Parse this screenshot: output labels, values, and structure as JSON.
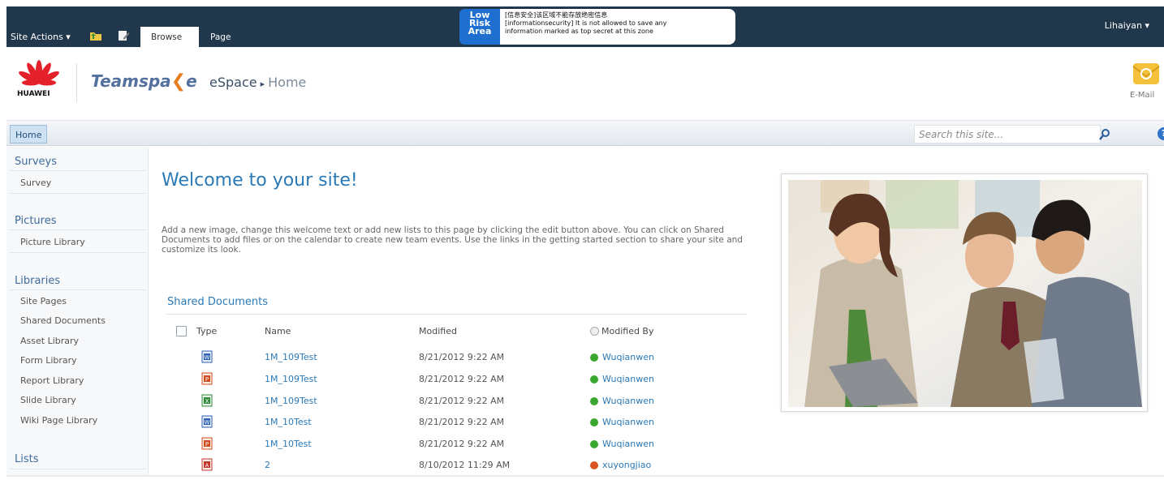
{
  "ribbon": {
    "site_actions": "Site Actions ▾",
    "tabs": [
      {
        "label": "Browse",
        "active": true
      },
      {
        "label": "Page",
        "active": false
      }
    ],
    "risk_badge": "Low Risk Area",
    "risk_badge_lines": [
      "Low",
      "Risk",
      "Area"
    ],
    "risk_message_cn": "[信息安全]该区域不能存放绝密信息",
    "risk_message_lines": [
      "[informationsecurity] It is not allowed to save any",
      "information marked as top secret at this zone"
    ],
    "user": "Lihaiyan ▾",
    "icons": [
      "folder-up-icon",
      "edit-page-icon"
    ]
  },
  "header": {
    "logo_text": "HUAWEI",
    "product_prefix": "Teamspa",
    "product_suffix": "e",
    "site_title": "eSpace",
    "current_page": "Home",
    "email_label": "E-Mail"
  },
  "topnav": {
    "home": "Home",
    "search_placeholder": "Search this site..."
  },
  "sidebar": {
    "sections": [
      {
        "heading": "Surveys",
        "items": [
          "Survey"
        ]
      },
      {
        "heading": "Pictures",
        "items": [
          "Picture Library"
        ]
      },
      {
        "heading": "Libraries",
        "items": [
          "Site Pages",
          "Shared Documents",
          "Asset Library",
          "Form Library",
          "Report Library",
          "Slide Library",
          "Wiki Page Library"
        ]
      },
      {
        "heading": "Lists",
        "items": []
      }
    ]
  },
  "main": {
    "welcome": "Welcome to your site!",
    "intro": "Add a new image, change this welcome text or add new lists to this page by clicking the edit button above. You can click on Shared Documents to add files or on the calendar to create new team events. Use the links in the getting started section to share your site and customize its look.",
    "shared_documents": {
      "title": "Shared Documents",
      "columns": [
        "Type",
        "Name",
        "Modified",
        "Modified By"
      ],
      "rows": [
        {
          "type": "word",
          "name": "1M_109Test",
          "modified": "8/21/2012 9:22 AM",
          "modified_by": "Wuqianwen",
          "presence": "online"
        },
        {
          "type": "powerpoint",
          "name": "1M_109Test",
          "modified": "8/21/2012 9:22 AM",
          "modified_by": "Wuqianwen",
          "presence": "online"
        },
        {
          "type": "excel",
          "name": "1M_109Test",
          "modified": "8/21/2012 9:22 AM",
          "modified_by": "Wuqianwen",
          "presence": "online"
        },
        {
          "type": "word",
          "name": "1M_10Test",
          "modified": "8/21/2012 9:22 AM",
          "modified_by": "Wuqianwen",
          "presence": "online"
        },
        {
          "type": "powerpoint",
          "name": "1M_10Test",
          "modified": "8/21/2012 9:22 AM",
          "modified_by": "Wuqianwen",
          "presence": "online"
        },
        {
          "type": "pdf",
          "name": "2",
          "modified": "8/10/2012 11:29 AM",
          "modified_by": "xuyongjiao",
          "presence": "busy"
        }
      ]
    }
  },
  "colors": {
    "ribbon_bg": "#21374c",
    "link_blue": "#2a79b7",
    "presence_online": "#3aa82e",
    "presence_busy": "#d9531e",
    "word": "#2b5fb4",
    "powerpoint": "#d04a1f",
    "excel": "#2f8a3a",
    "pdf": "#c0392b"
  }
}
